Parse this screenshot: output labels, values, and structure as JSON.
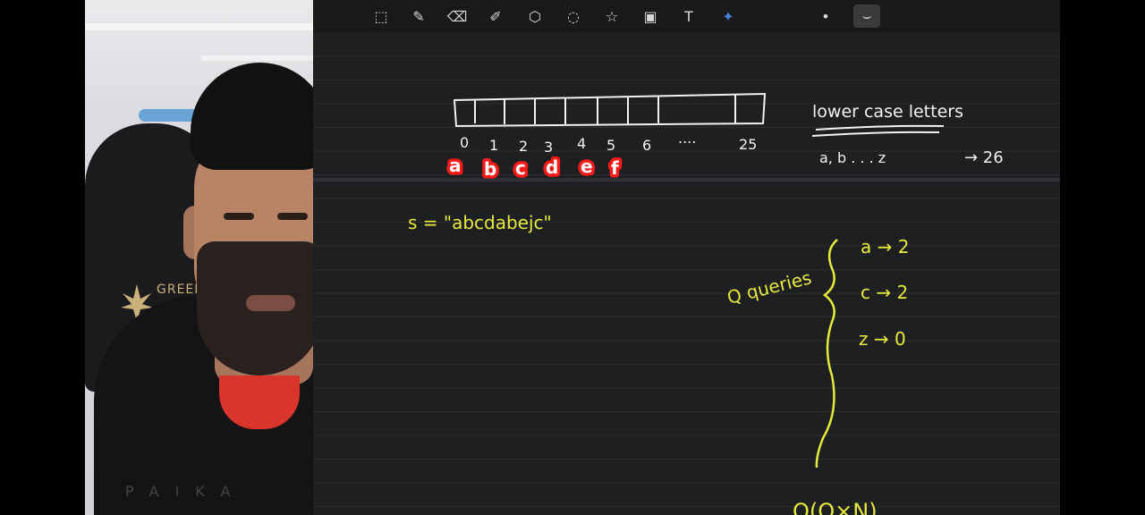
{
  "toolbar": {
    "tools": [
      {
        "name": "lasso-select-icon",
        "glyph": "⬚"
      },
      {
        "name": "pen-icon",
        "glyph": "✎"
      },
      {
        "name": "eraser-icon",
        "glyph": "⌫"
      },
      {
        "name": "highlighter-icon",
        "glyph": "✐"
      },
      {
        "name": "shapes-icon",
        "glyph": "⬡"
      },
      {
        "name": "lasso-icon",
        "glyph": "◌"
      },
      {
        "name": "sticker-icon",
        "glyph": "☆"
      },
      {
        "name": "image-icon",
        "glyph": "▣"
      },
      {
        "name": "text-icon",
        "glyph": "T"
      },
      {
        "name": "laser-pointer-icon",
        "glyph": "✦"
      },
      {
        "name": "dot-size-icon",
        "glyph": "•"
      },
      {
        "name": "stroke-style-icon",
        "glyph": "⌣"
      }
    ]
  },
  "webcam": {
    "chair_brand": "GREEN",
    "hoodie_print": "PAIKA"
  },
  "notes": {
    "indices": [
      "0",
      "1",
      "2",
      "3",
      "4",
      "5",
      "6",
      "....",
      "25"
    ],
    "letters": [
      "a",
      "b",
      "c",
      "d",
      "e",
      "f"
    ],
    "lowercase_title": "lower case letters",
    "range": "a, b . . . z",
    "range_arrow": "→ 26",
    "string_def": "s = \"abcdabejc\"",
    "queries_label": "Q queries",
    "query_rows": [
      "a → 2",
      "c → 2",
      "z → 0"
    ],
    "complexity": "O(Q×N)"
  }
}
